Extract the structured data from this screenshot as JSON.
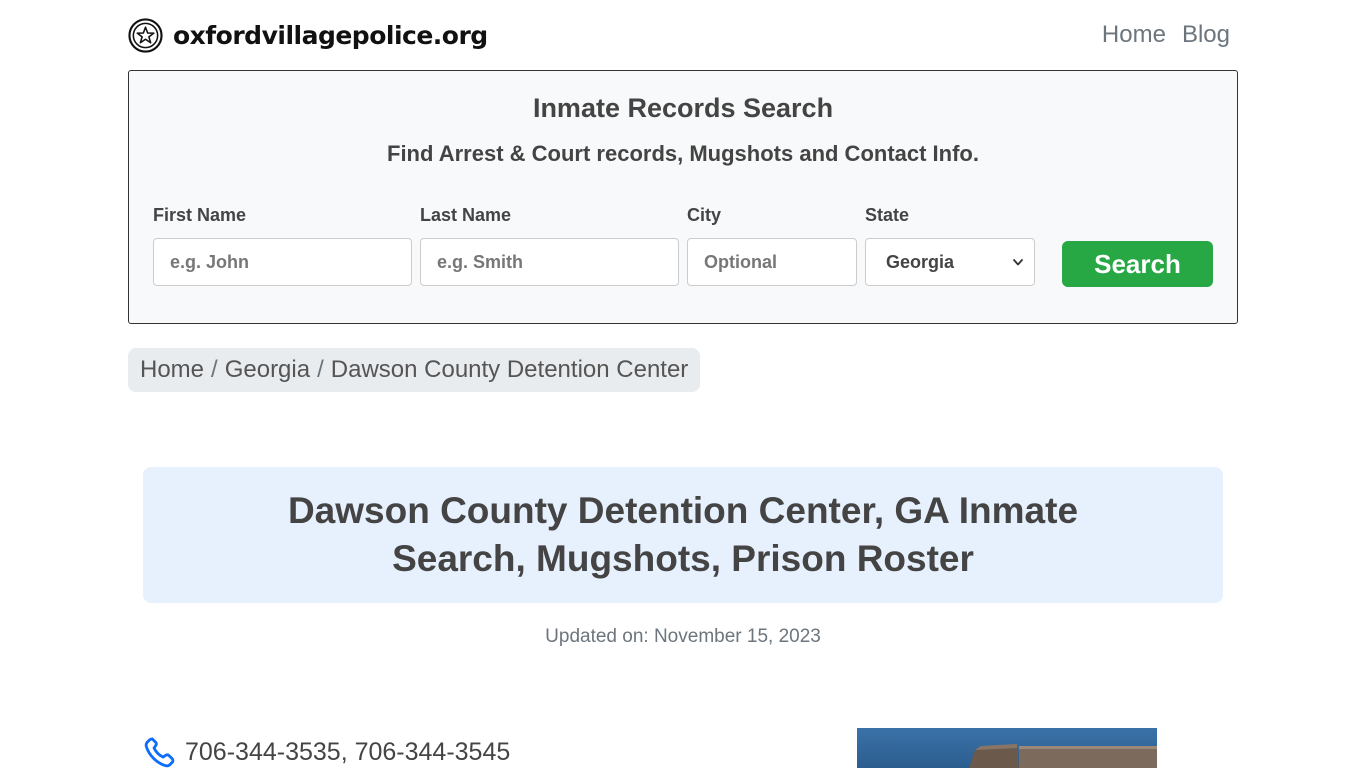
{
  "header": {
    "site_name": "oxfordvillagepolice.org",
    "logo_icon": "star-badge-icon",
    "nav": [
      {
        "label": "Home"
      },
      {
        "label": "Blog"
      }
    ]
  },
  "search": {
    "title": "Inmate Records Search",
    "subtitle": "Find Arrest & Court records, Mugshots and Contact Info.",
    "first_name": {
      "label": "First Name",
      "placeholder": "e.g. John",
      "value": ""
    },
    "last_name": {
      "label": "Last Name",
      "placeholder": "e.g. Smith",
      "value": ""
    },
    "city": {
      "label": "City",
      "placeholder": "Optional",
      "value": ""
    },
    "state": {
      "label": "State",
      "selected": "Georgia"
    },
    "button_label": "Search"
  },
  "breadcrumb": [
    {
      "label": "Home"
    },
    {
      "label": "Georgia"
    },
    {
      "label": "Dawson County Detention Center"
    }
  ],
  "breadcrumb_separator": "/",
  "main": {
    "title": "Dawson County Detention Center, GA Inmate Search, Mugshots, Prison Roster",
    "updated": "Updated on: November 15, 2023"
  },
  "contact": {
    "phone_icon": "phone-icon",
    "phones": "706-344-3535, 706-344-3545"
  },
  "colors": {
    "accent_green": "#28a745",
    "title_background": "#e7f0fd",
    "link_blue": "#0d6efd",
    "text": "#444444"
  }
}
